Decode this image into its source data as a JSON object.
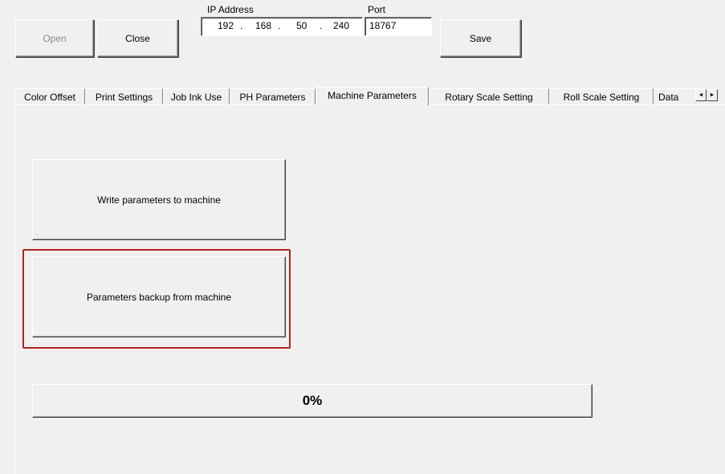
{
  "toolbar": {
    "open_label": "Open",
    "close_label": "Close",
    "save_label": "Save",
    "ip_label": "IP Address",
    "port_label": "Port",
    "ip": {
      "seg1": "192",
      "seg2": "168",
      "seg3": "50",
      "seg4": "240",
      "dot": "."
    },
    "port_value": "18767"
  },
  "tabs": [
    {
      "label": "Color Offset"
    },
    {
      "label": "Print Settings"
    },
    {
      "label": "Job Ink Use"
    },
    {
      "label": "PH Parameters"
    },
    {
      "label": "Machine Parameters"
    },
    {
      "label": "Rotary Scale Setting"
    },
    {
      "label": "Roll Scale Setting"
    },
    {
      "label": "Data"
    }
  ],
  "active_tab": "Machine Parameters",
  "tab_scroll": {
    "left_icon": "scroll-left-icon",
    "right_icon": "scroll-right-icon",
    "left_glyph": "◄",
    "right_glyph": "►"
  },
  "panel": {
    "write_button_label": "Write parameters to machine",
    "backup_button_label": "Parameters backup from machine",
    "progress_text": "0%",
    "progress_value": 0
  },
  "colors": {
    "highlight": "#b22222",
    "progress_fill": "#3a7bd5"
  }
}
